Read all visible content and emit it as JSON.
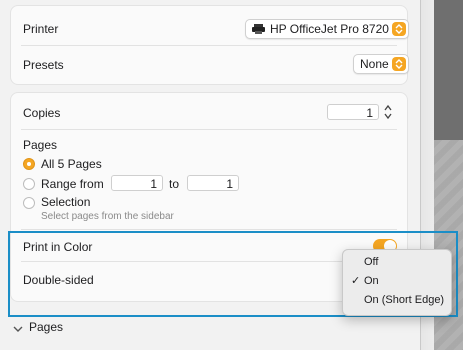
{
  "printer": {
    "label": "Printer",
    "value": "HP OfficeJet Pro 8720"
  },
  "presets": {
    "label": "Presets",
    "value": "None"
  },
  "copies": {
    "label": "Copies",
    "value": "1"
  },
  "pages": {
    "heading": "Pages",
    "all_label": "All 5 Pages",
    "range_label": "Range from",
    "range_from": "1",
    "range_to_label": "to",
    "range_to": "1",
    "selection_label": "Selection",
    "selection_hint": "Select pages from the sidebar",
    "selected_option": "all"
  },
  "print_in_color": {
    "label": "Print in Color",
    "state": "on"
  },
  "double_sided": {
    "label": "Double-sided"
  },
  "menu": {
    "items": [
      {
        "label": "Off",
        "checked": false
      },
      {
        "label": "On",
        "checked": true
      },
      {
        "label": "On (Short Edge)",
        "checked": false
      }
    ],
    "check_glyph": "✓"
  },
  "pages_section": {
    "label": "Pages"
  },
  "colors": {
    "accent": "#f5a623",
    "highlight": "#1b8ec7"
  },
  "icons": {
    "printer": "printer-icon",
    "stepper": "stepper-arrows-icon",
    "chevron": "chevron-down-icon"
  }
}
